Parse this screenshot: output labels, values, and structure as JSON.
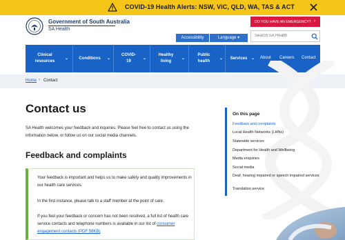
{
  "alert": {
    "text": "COVID-19 Health Alerts: NSW, VIC, QLD, WA, TAS & ACT",
    "icons": {
      "warning": "warning-icon",
      "close": "close-icon"
    }
  },
  "header": {
    "org_name": "Government of South Australia",
    "org_sub": "SA Health",
    "emergency_label": "DO YOU HAVE AN EMERGENCY?",
    "emergency_chevron": "›",
    "accessibility_label": "Accessibility",
    "language_label": "Language ▾",
    "search_placeholder": "Search SA Health"
  },
  "nav": {
    "items": [
      {
        "line1": "Clinical",
        "line2": "resources",
        "chev": "⌄"
      },
      {
        "line1": "Conditions",
        "line2": "",
        "chev": "⌄"
      },
      {
        "line1": "COVID-",
        "line2": "19",
        "chev": "⌄"
      },
      {
        "line1": "Healthy",
        "line2": "living",
        "chev": "⌄"
      },
      {
        "line1": "Public",
        "line2": "health",
        "chev": "⌄"
      },
      {
        "line1": "Services",
        "line2": "",
        "chev": "⌄"
      }
    ],
    "links": [
      "About",
      "Careers",
      "Contact"
    ]
  },
  "breadcrumb": {
    "home": "Home",
    "sep": "›",
    "current": "Contact"
  },
  "main": {
    "title": "Contact us",
    "intro": "SA Health welcomes your feedback and inquiries. Please feel free to contact us using the information below, or follow us on our social media channels.",
    "section_title": "Feedback and complaints",
    "callout": {
      "p1": "Your feedback is important and helps us to make safety and quality improvements in our health care services.",
      "p2": "In the first instance, please talk to a staff member at the point of care.",
      "p3_text": "If you feel your feedback or concern has not been resolved, a full list of health care service contacts and telephone numbers is available in our list of ",
      "p3_link": "consumer engagement contacts (PDF 58KB)"
    }
  },
  "on_this_page": {
    "title": "On this page",
    "items": [
      "Feedback and complaints",
      "Local Health Networks (LHNs)",
      "Statewide services",
      "Department for Health and Wellbeing",
      "Media enquiries",
      "Social media",
      "Deaf, hearing impaired or speech impaired services",
      "Translation service"
    ]
  },
  "colors": {
    "alert_bg": "#f5c518",
    "emergency": "#d7193f",
    "nav_bg": "#1a63c6",
    "util_bg": "#2e6fc9",
    "gov_navy": "#1b3a6b",
    "callout_border": "#6ab23e"
  }
}
